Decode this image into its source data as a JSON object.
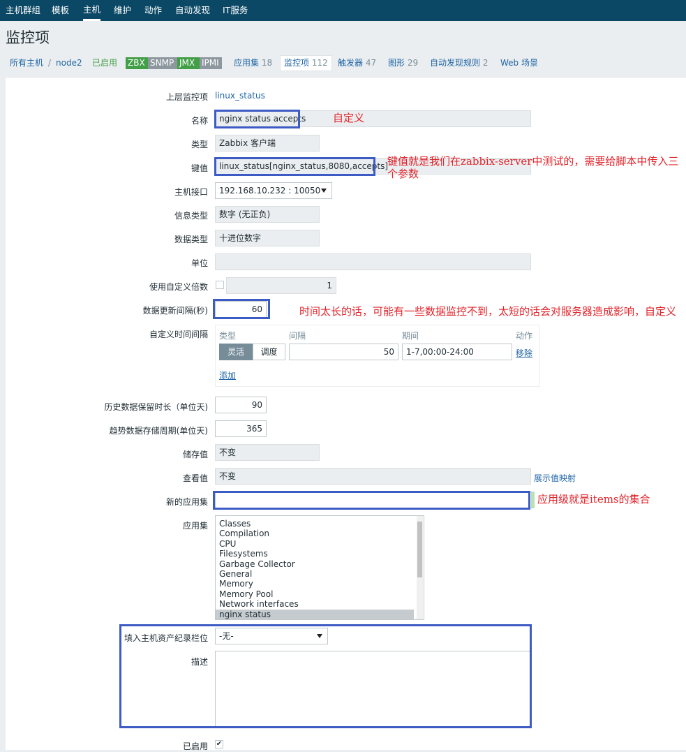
{
  "topnav": {
    "items": [
      "主机群组",
      "模板",
      "主机",
      "维护",
      "动作",
      "自动发现",
      "IT服务"
    ],
    "active_index": 2
  },
  "page_title": "监控项",
  "breadcrumb": {
    "all_hosts": "所有主机",
    "sep": "/",
    "host": "node2",
    "enabled": "已启用",
    "badges": [
      {
        "label": "ZBX",
        "color": "#429e47"
      },
      {
        "label": "SNMP",
        "color": "#8c979e"
      },
      {
        "label": "JMX",
        "color": "#429e47"
      },
      {
        "label": "IPMI",
        "color": "#8c979e"
      }
    ],
    "tabs": [
      {
        "label": "应用集",
        "count": "18"
      },
      {
        "label": "监控项",
        "count": "112"
      },
      {
        "label": "触发器",
        "count": "47"
      },
      {
        "label": "图形",
        "count": "29"
      },
      {
        "label": "自动发现规则",
        "count": "2"
      },
      {
        "label": "Web 场景",
        "count": ""
      }
    ]
  },
  "form": {
    "parent_label": "上层监控项",
    "parent_value": "linux_status",
    "name_label": "名称",
    "name_value": "nginx status accepts",
    "type_label": "类型",
    "type_value": "Zabbix 客户端",
    "key_label": "键值",
    "key_value": "linux_status[nginx_status,8080,accepts]",
    "interface_label": "主机接口",
    "interface_value": "192.168.10.232 : 10050",
    "info_type_label": "信息类型",
    "info_type_value": "数字 (无正负)",
    "data_type_label": "数据类型",
    "data_type_value": "十进位数字",
    "units_label": "单位",
    "units_value": "",
    "multiplier_label": "使用自定义倍数",
    "multiplier_value": "1",
    "interval_label": "数据更新间隔(秒)",
    "interval_value": "60",
    "custom_interval_label": "自定义时间间隔",
    "custom_interval": {
      "col_type": "类型",
      "col_interval": "间隔",
      "col_period": "期间",
      "col_action": "动作",
      "flex": "灵活",
      "schedule": "调度",
      "interval_value": "50",
      "period_value": "1-7,00:00-24:00",
      "remove": "移除",
      "add": "添加"
    },
    "history_label": "历史数据保留时长（单位天)",
    "history_value": "90",
    "trends_label": "趋势数据存储周期(单位天)",
    "trends_value": "365",
    "store_label": "储存值",
    "store_value": "不变",
    "show_label": "查看值",
    "show_value": "不变",
    "show_mapping_link": "展示值映射",
    "new_app_label": "新的应用集",
    "new_app_value": "",
    "apps_label": "应用集",
    "apps": [
      "Classes",
      "Compilation",
      "CPU",
      "Filesystems",
      "Garbage Collector",
      "General",
      "Memory",
      "Memory Pool",
      "Network interfaces",
      "nginx status"
    ],
    "apps_selected": "nginx status",
    "inventory_label": "填入主机资产纪录栏位",
    "inventory_value": "-无-",
    "desc_label": "描述",
    "desc_value": "",
    "enabled_label": "已启用"
  },
  "annotations": {
    "name": "自定义",
    "key": "键值就是我们在zabbix-server中测试的，需要给脚本中传入三个参数",
    "interval": "时间太长的话，可能有一些数据监控不到，太短的话会对服务器造成影响，自定义",
    "new_app": "应用级就是items的集合"
  },
  "colors": {
    "topnav": "#0b4865",
    "highlight": "#3d5bc4",
    "annotation": "#e2232a",
    "link": "#1f65a6"
  }
}
